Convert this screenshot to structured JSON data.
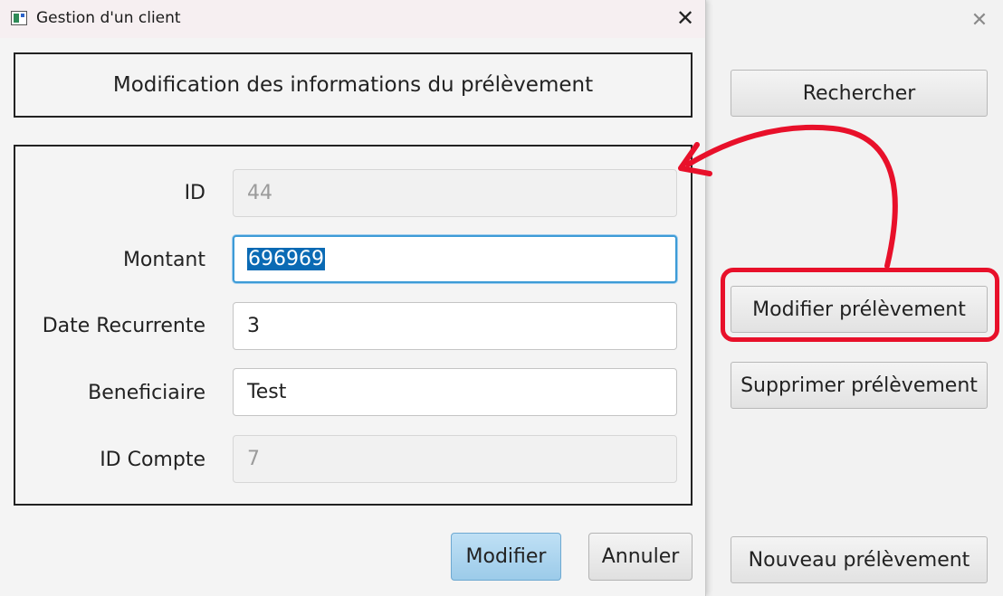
{
  "dialog": {
    "title": "Gestion d'un client",
    "close_symbol": "✕",
    "header": "Modification des informations du prélèvement",
    "fields": [
      {
        "label": "ID",
        "value": "44",
        "state": "disabled"
      },
      {
        "label": "Montant",
        "value": "696969",
        "state": "focused-selected"
      },
      {
        "label": "Date Recurrente",
        "value": "3",
        "state": "enabled"
      },
      {
        "label": "Beneficiaire",
        "value": "Test",
        "state": "enabled"
      },
      {
        "label": "ID Compte",
        "value": "7",
        "state": "disabled"
      }
    ],
    "buttons": {
      "modifier": "Modifier",
      "annuler": "Annuler"
    }
  },
  "background_window": {
    "close_symbol": "✕",
    "buttons": {
      "rechercher": "Rechercher",
      "modifier": "Modifier prélèvement",
      "supprimer": "Supprimer prélèvement",
      "nouveau": "Nouveau prélèvement"
    }
  },
  "annotation": {
    "highlight_color": "#e8102a",
    "icon": "curved-arrow-icon"
  }
}
